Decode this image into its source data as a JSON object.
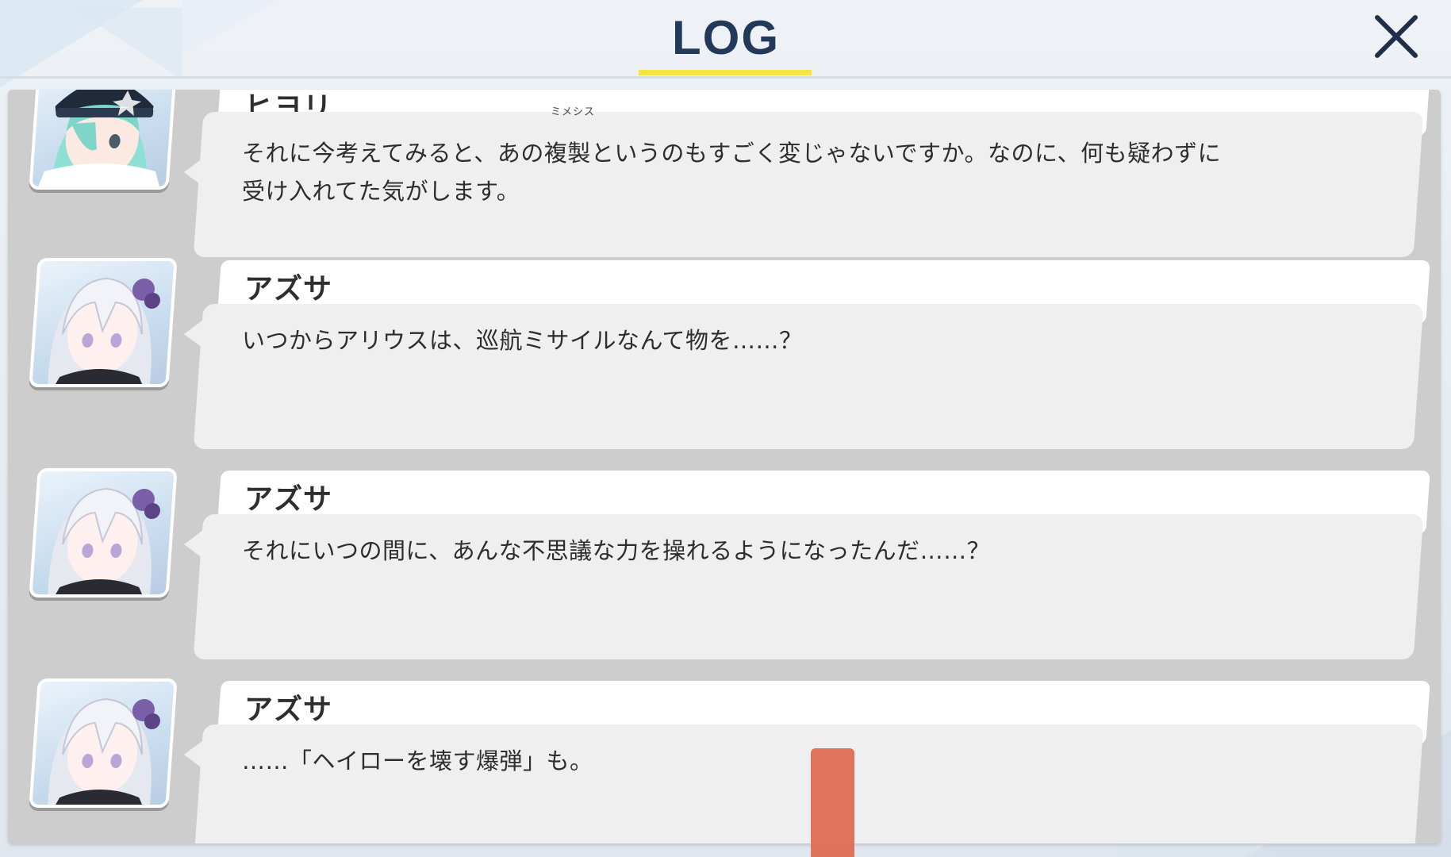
{
  "header": {
    "title": "LOG"
  },
  "colors": {
    "accent": "#f3e545",
    "title": "#23395a",
    "scroll_handle": "#de6b52"
  },
  "icons": {
    "close": "close-icon"
  },
  "entries": [
    {
      "speaker": "ヒヨリ",
      "ruby": "ミメシス",
      "text": "それに今考えてみると、あの複製というのもすごく変じゃないですか。なのに、何も疑わずに\n受け入れてた気がします。"
    },
    {
      "speaker": "アズサ",
      "text": "いつからアリウスは、巡航ミサイルなんて物を……？"
    },
    {
      "speaker": "アズサ",
      "text": "それにいつの間に、あんな不思議な力を操れるようになったんだ……？"
    },
    {
      "speaker": "アズサ",
      "text": "……「ヘイローを壊す爆弾」も。"
    }
  ]
}
